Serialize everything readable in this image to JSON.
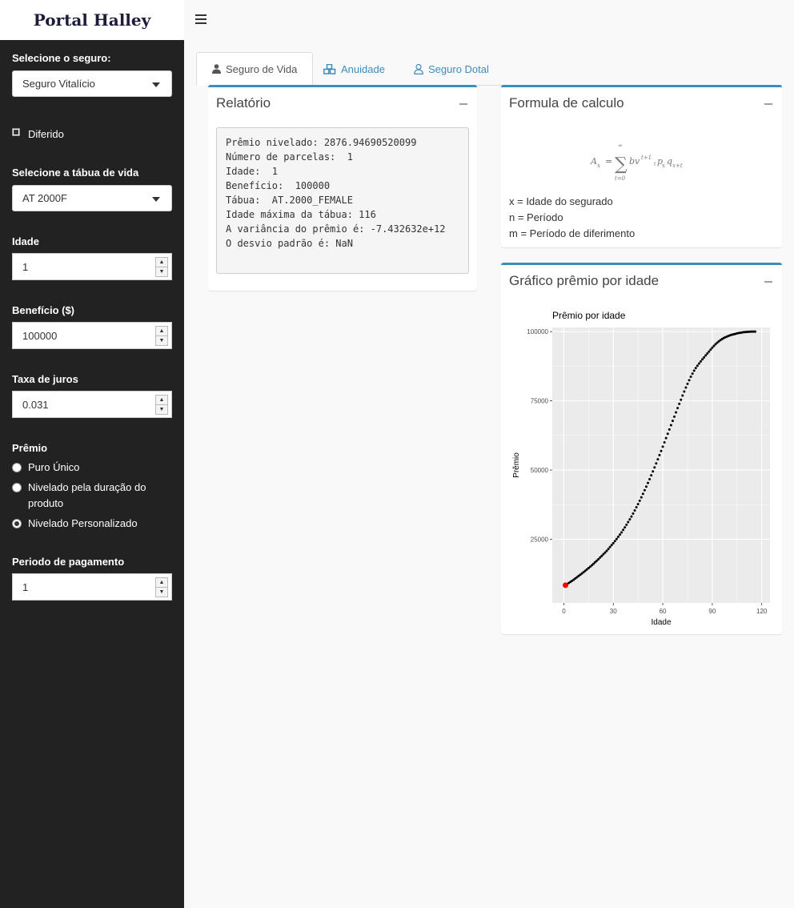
{
  "brand": "Portal Halley",
  "sidebar": {
    "seguro_label": "Selecione o seguro:",
    "seguro_value": "Seguro Vitalício",
    "diferido_label": "Diferido",
    "tabua_label": "Selecione a tábua de vida",
    "tabua_value": "AT 2000F",
    "idade_label": "Idade",
    "idade_value": "1",
    "beneficio_label": "Benefício ($)",
    "beneficio_value": "100000",
    "taxa_label": "Taxa de juros",
    "taxa_value": "0.031",
    "premio_label": "Prêmio",
    "premio_options": [
      "Puro Único",
      "Nivelado pela duração do produto",
      "Nivelado Personalizado"
    ],
    "premio_selected": 2,
    "periodo_label": "Periodo de pagamento",
    "periodo_value": "1"
  },
  "tabs": [
    "Seguro de Vida",
    "Anuidade",
    "Seguro Dotal"
  ],
  "active_tab": 0,
  "relatorio": {
    "title": "Relatório",
    "text": "Prêmio nivelado: 2876.94690520099\nNúmero de parcelas:  1\nIdade:  1\nBenefício:  100000\nTábua:  AT.2000_FEMALE\nIdade máxima da tábua: 116\nA variância do prêmio é: -7.432632e+12\nO desvio padrão é: NaN"
  },
  "formula": {
    "title": "Formula de calculo",
    "lines": [
      "x = Idade do segurado",
      "n = Período",
      "m = Período de diferimento"
    ]
  },
  "grafico": {
    "title": "Gráfico prêmio por idade"
  },
  "chart_data": {
    "type": "scatter",
    "title": "Prêmio por idade",
    "xlabel": "Idade",
    "ylabel": "Prêmio",
    "xlim": [
      -7,
      125
    ],
    "ylim": [
      2000,
      101500
    ],
    "xticks": [
      0,
      30,
      60,
      90,
      120
    ],
    "yticks": [
      25000,
      50000,
      75000,
      100000
    ],
    "grid": true,
    "highlight": {
      "x": 1,
      "y": 8400,
      "color": "#ff0000"
    },
    "x": [
      1,
      2,
      3,
      4,
      5,
      6,
      7,
      8,
      9,
      10,
      11,
      12,
      13,
      14,
      15,
      16,
      17,
      18,
      19,
      20,
      21,
      22,
      23,
      24,
      25,
      26,
      27,
      28,
      29,
      30,
      31,
      32,
      33,
      34,
      35,
      36,
      37,
      38,
      39,
      40,
      41,
      42,
      43,
      44,
      45,
      46,
      47,
      48,
      49,
      50,
      51,
      52,
      53,
      54,
      55,
      56,
      57,
      58,
      59,
      60,
      61,
      62,
      63,
      64,
      65,
      66,
      67,
      68,
      69,
      70,
      71,
      72,
      73,
      74,
      75,
      76,
      77,
      78,
      79,
      80,
      81,
      82,
      83,
      84,
      85,
      86,
      87,
      88,
      89,
      90,
      91,
      92,
      93,
      94,
      95,
      96,
      97,
      98,
      99,
      100,
      101,
      102,
      103,
      104,
      105,
      106,
      107,
      108,
      109,
      110,
      111,
      112,
      113,
      114,
      115,
      116
    ],
    "y": [
      8400,
      8800,
      9200,
      9600,
      10000,
      10400,
      10850,
      11300,
      11750,
      12200,
      12650,
      13100,
      13600,
      14100,
      14600,
      15100,
      15600,
      16150,
      16700,
      17250,
      17800,
      18400,
      19000,
      19600,
      20200,
      20800,
      21500,
      22200,
      22900,
      23600,
      24350,
      25100,
      25900,
      26700,
      27500,
      28400,
      29300,
      30250,
      31200,
      32200,
      33200,
      34300,
      35400,
      36550,
      37700,
      38900,
      40150,
      41400,
      42700,
      44000,
      45350,
      46700,
      48100,
      49500,
      50950,
      52400,
      53900,
      55400,
      56900,
      58450,
      60000,
      61550,
      63100,
      64650,
      66200,
      67750,
      69300,
      70850,
      72400,
      73900,
      75400,
      76900,
      78350,
      79800,
      81150,
      82450,
      83700,
      84850,
      85900,
      86850,
      87700,
      88500,
      89250,
      90000,
      90700,
      91400,
      92100,
      92800,
      93500,
      94200,
      94850,
      95450,
      96000,
      96500,
      96950,
      97350,
      97700,
      98000,
      98250,
      98500,
      98700,
      98900,
      99050,
      99200,
      99350,
      99500,
      99600,
      99700,
      99800,
      99850,
      99900,
      99950,
      99980,
      100000,
      100000,
      100000
    ]
  }
}
